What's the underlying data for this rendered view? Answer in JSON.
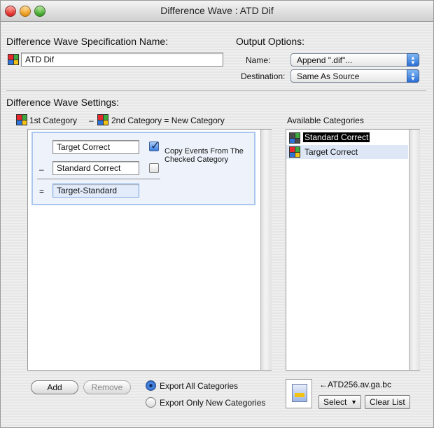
{
  "window": {
    "title": "Difference Wave : ATD Dif"
  },
  "spec": {
    "label": "Difference Wave Specification Name:",
    "value": "ATD Dif",
    "icon": "grid-icon"
  },
  "output": {
    "label": "Output Options:",
    "name_label": "Name:",
    "name_value": "Append \".dif\"...",
    "dest_label": "Destination:",
    "dest_value": "Same As Source"
  },
  "settings": {
    "label": "Difference Wave Settings:",
    "formula": {
      "first": "1st Category",
      "minus": "–",
      "second": "2nd Category = New Category"
    },
    "rows": {
      "first_value": "Target Correct",
      "second_value": "Standard Correct",
      "result_value": "Target-Standard",
      "minus_sign": "–",
      "equals_sign": "=",
      "first_checked": true,
      "second_checked": false
    },
    "copy_events_label": "Copy Events From The Checked Category"
  },
  "available": {
    "label": "Available Categories",
    "items": [
      {
        "label": "Standard Correct",
        "selected": true
      },
      {
        "label": "Target Correct",
        "selected": false
      }
    ]
  },
  "buttons": {
    "add": "Add",
    "remove": "Remove",
    "select": "Select",
    "clear": "Clear List"
  },
  "export": {
    "all_label": "Export All Categories",
    "new_label": "Export Only New Categories",
    "selected": "all"
  },
  "file": {
    "name": "ATD256.av.ga.bc",
    "arrow": "←"
  },
  "colors": {
    "grid_red": "#e8282c",
    "grid_green": "#3ea93c",
    "grid_blue": "#2f73d8",
    "grid_yellow": "#f2c313",
    "selection_dark": "#000000",
    "selection_light": "#dde7f5"
  }
}
